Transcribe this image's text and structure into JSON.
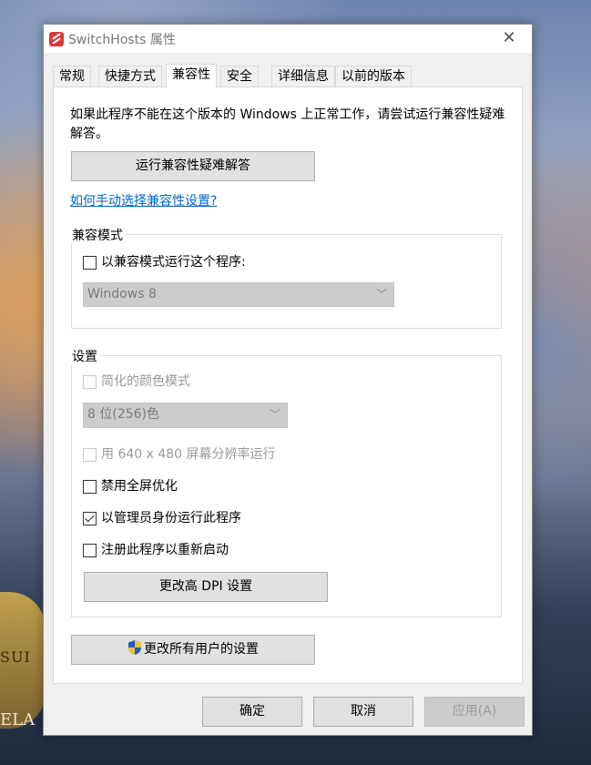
{
  "window": {
    "title": "SwitchHosts 属性",
    "close_glyph": "✕"
  },
  "tabs": [
    {
      "label": "常规",
      "active": false
    },
    {
      "label": "快捷方式",
      "active": false
    },
    {
      "label": "兼容性",
      "active": true
    },
    {
      "label": "安全",
      "active": false
    },
    {
      "label": "详细信息",
      "active": false
    },
    {
      "label": "以前的版本",
      "active": false
    }
  ],
  "compat": {
    "description": "如果此程序不能在这个版本的 Windows 上正常工作，请尝试运行兼容性疑难解答。",
    "troubleshooter_button": "运行兼容性疑难解答",
    "manual_link": "如何手动选择兼容性设置?",
    "mode_group_title": "兼容模式",
    "mode_checkbox_label": "以兼容模式运行这个程序:",
    "mode_checkbox_checked": false,
    "mode_select_value": "Windows 8"
  },
  "settings": {
    "group_title": "设置",
    "reduced_color_label": "简化的颜色模式",
    "reduced_color_checked": false,
    "color_select_value": "8 位(256)色",
    "res_640_label": "用 640 x 480 屏幕分辨率运行",
    "res_640_checked": false,
    "disable_fullscreen_label": "禁用全屏优化",
    "disable_fullscreen_checked": false,
    "run_as_admin_label": "以管理员身份运行此程序",
    "run_as_admin_checked": true,
    "register_restart_label": "注册此程序以重新启动",
    "register_restart_checked": false,
    "dpi_button": "更改高 DPI 设置"
  },
  "all_users_button": "更改所有用户的设置",
  "footer": {
    "ok": "确定",
    "cancel": "取消",
    "apply": "应用(A)"
  },
  "background": {
    "sign_text_1": "SUI",
    "sign_text_2": "ELA"
  },
  "colors": {
    "link": "#0066cc",
    "dialog_bg": "#f0f0f0",
    "disabled_text": "#9a9a9a"
  }
}
